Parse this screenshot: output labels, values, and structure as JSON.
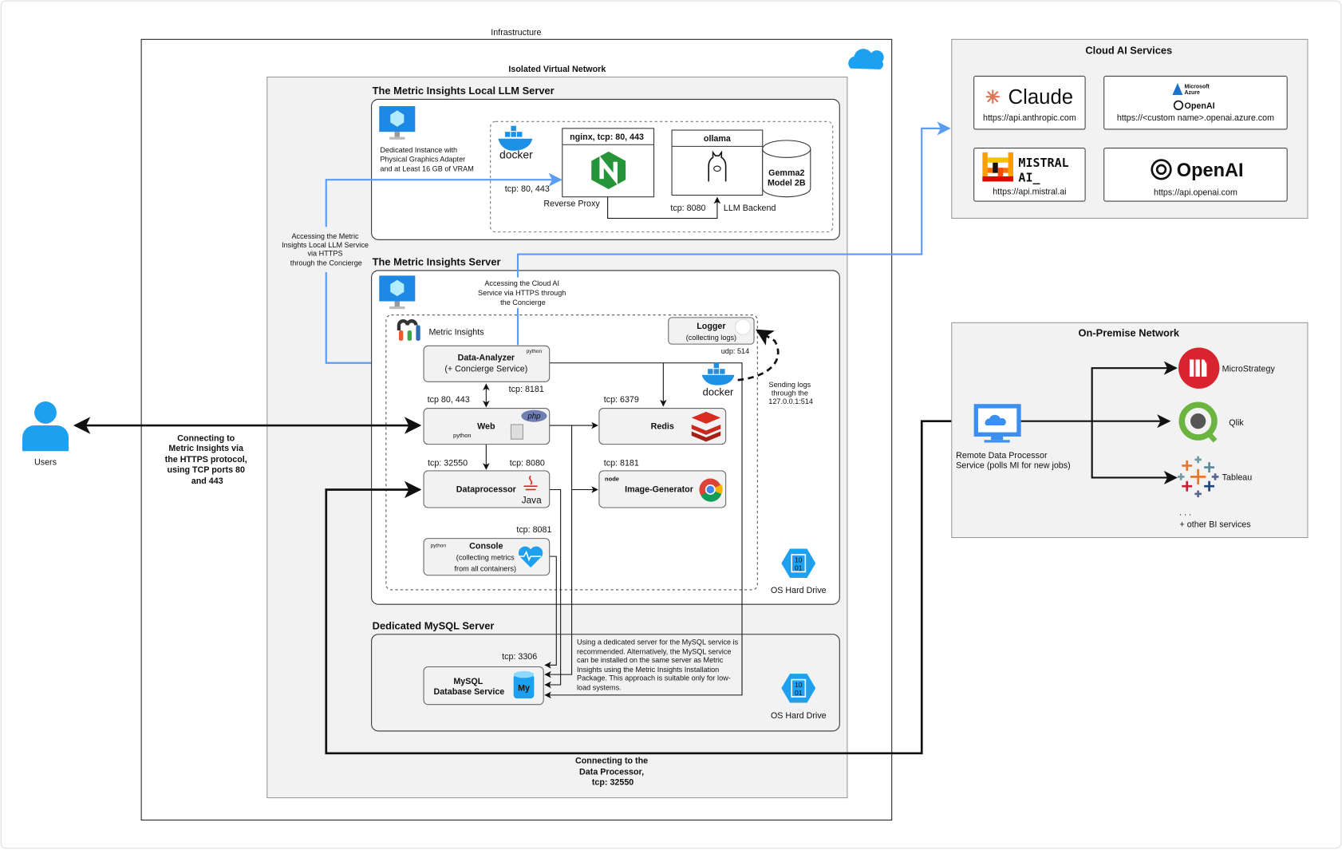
{
  "infrastructure": {
    "label": "Infrastructure"
  },
  "network": {
    "label": "Isolated Virtual Network"
  },
  "llm_server": {
    "title": "The Metric Insights Local LLM Server",
    "instance_desc": [
      "Dedicated Instance with",
      "Physical Graphics Adapter",
      "and at Least 16 GB of VRAM"
    ],
    "docker_label": "docker",
    "nginx": {
      "title": "nginx, tcp: 80, 443",
      "port": "tcp: 80, 443",
      "role": "Reverse Proxy"
    },
    "ollama": {
      "title": "ollama",
      "port": "tcp: 8080",
      "role": "LLM Backend"
    },
    "model": [
      "Gemma2",
      "Model 2B"
    ]
  },
  "annotations": {
    "local_llm_access": [
      "Accessing the Metric",
      "Insights Local LLM Service",
      "via HTTPS",
      "through the Concierge"
    ],
    "cloud_ai_access": [
      "Accessing the Cloud AI",
      "Service via HTTPS through",
      "the Concierge"
    ],
    "users_connect": [
      "Connecting to",
      "Metric Insights via",
      "the HTTPS protocol,",
      "using TCP ports 80",
      "and 443"
    ],
    "dp_connect": [
      "Connecting to the",
      "Data Processor,",
      "tcp: 32550"
    ],
    "sending_logs": [
      "Sending logs",
      "through the",
      "127.0.0.1:514"
    ]
  },
  "mi_server": {
    "title": "The Metric Insights Server",
    "brand": "Metric Insights",
    "docker_label": "docker",
    "logger": {
      "title": "Logger",
      "sub": "(collecting logs)",
      "port": "udp: 514"
    },
    "data_analyzer": {
      "title": "Data-Analyzer",
      "sub": "(+ Concierge Service)",
      "port": "tcp: 8181",
      "badge": "python"
    },
    "web": {
      "title": "Web",
      "port": "tcp 80, 443",
      "badge_php": "php",
      "badge_python": "python"
    },
    "redis": {
      "title": "Redis",
      "port": "tcp: 6379"
    },
    "dataprocessor": {
      "title": "Dataprocessor",
      "port_in": "tcp: 32550",
      "port": "tcp: 8080",
      "badge": "Java"
    },
    "image_generator": {
      "title": "Image-Generator",
      "port": "tcp: 8181",
      "badge": "node"
    },
    "console": {
      "title": "Console",
      "sub": [
        "(collecting metrics",
        "from all containers)"
      ],
      "port": "tcp: 8081",
      "badge": "python"
    },
    "drive": {
      "label": "OS Hard Drive",
      "glyph": [
        "10",
        "01"
      ]
    }
  },
  "mysql_server": {
    "title": "Dedicated MySQL Server",
    "service": [
      "MySQL",
      "Database Service"
    ],
    "port": "tcp: 3306",
    "icon_text": "My",
    "note": [
      "Using a dedicated server for the MySQL service is",
      "recommended. Alternatively, the MySQL service",
      "can be installed on the same server as Metric",
      "Insights using the Metric Insights Installation",
      "Package. This approach is suitable only for low-",
      "load systems."
    ],
    "drive": {
      "label": "OS Hard Drive",
      "glyph": [
        "10",
        "01"
      ]
    }
  },
  "users": {
    "label": "Users"
  },
  "cloud_ai": {
    "title": "Cloud AI Services",
    "providers": [
      {
        "name": "Claude",
        "url": "https://api.anthropic.com"
      },
      {
        "name": "OpenAI",
        "brand": [
          "Microsoft",
          "Azure"
        ],
        "url": "https://<custom name>.openai.azure.com"
      },
      {
        "name": [
          "MISTRAL",
          "AI_"
        ],
        "url": "https://api.mistral.ai"
      },
      {
        "name": "OpenAI",
        "url": "https://api.openai.com"
      }
    ]
  },
  "on_premise": {
    "title": "On-Premise Network",
    "remote_dp": [
      "Remote Data Processor",
      "Service (polls MI for new jobs)"
    ],
    "bi_services": [
      "MicroStrategy",
      "Qlik",
      "Tableau"
    ],
    "ellipsis": ". . .",
    "other": "+ other BI services"
  },
  "colors": {
    "blue_link": "#5b9cf2",
    "azure": "#1ea0f0",
    "frame": "#333333",
    "panel": "#f2f2f2",
    "nginx": "#269539",
    "redis": "#d82c20",
    "microstrategy": "#d9232e",
    "qlik": "#6bb43f"
  }
}
